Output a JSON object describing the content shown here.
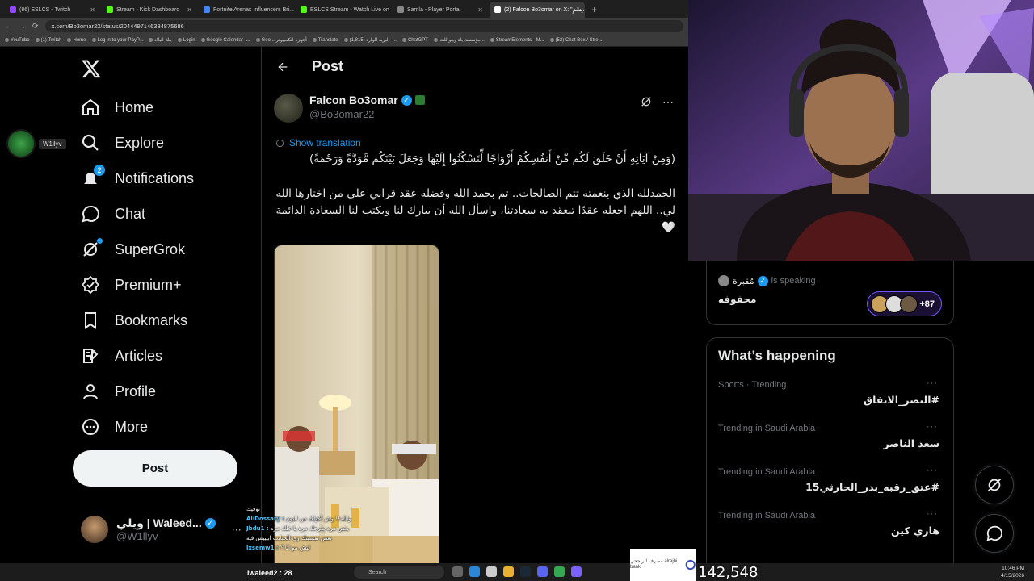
{
  "browser": {
    "tabs": [
      {
        "label": "(86) ESLCS - Twitch",
        "color": "#9146ff"
      },
      {
        "label": "Stream - Kick Dashboard",
        "color": "#53fc18"
      },
      {
        "label": "Fortnite Arenas Influencers Bri...",
        "color": "#4285f4"
      },
      {
        "label": "ESLCS Stream - Watch Live on ...",
        "color": "#53fc18"
      },
      {
        "label": "Samla - Player Portal",
        "color": "#888888"
      },
      {
        "label": "(2) Falcon Bo3omar on X: \"بِسْمِ...",
        "color": "#ffffff",
        "active": true
      }
    ],
    "new_tab": "+",
    "url": "x.com/Bo3omar22/status/2044497146334875686",
    "bookmarks": [
      "YouTube",
      "(1) Twitch",
      "Home",
      "Log in to your PayP...",
      "بنك البلاد",
      "Login",
      "Google Calendar -...",
      "Goo... أجهزة الكمبيوتر",
      "Translate",
      "(1,815) البريد الوارد -...",
      "ChatGPT",
      "مؤسسة باه ويلو للت...",
      "StreamElements - M...",
      "(52) Chat Box / Stre..."
    ]
  },
  "sidebar": {
    "items": [
      {
        "label": "Home",
        "icon": "home-icon"
      },
      {
        "label": "Explore",
        "icon": "search-icon"
      },
      {
        "label": "Notifications",
        "icon": "bell-icon",
        "badge": "2"
      },
      {
        "label": "Chat",
        "icon": "chat-icon"
      },
      {
        "label": "SuperGrok",
        "icon": "grok-icon"
      },
      {
        "label": "Premium+",
        "icon": "premium-icon"
      },
      {
        "label": "Bookmarks",
        "icon": "bookmark-icon"
      },
      {
        "label": "Articles",
        "icon": "articles-icon"
      },
      {
        "label": "Profile",
        "icon": "profile-icon"
      },
      {
        "label": "More",
        "icon": "more-icon"
      }
    ],
    "post_button": "Post",
    "account": {
      "name": "ويلي | Waleed...",
      "handle": "@W1llyv"
    },
    "overlay_user": "W1llyv"
  },
  "post": {
    "header_title": "Post",
    "author_name": "Falcon Bo3omar",
    "author_handle": "@Bo3omar22",
    "show_translation": "Show translation",
    "verse": "(وَمِنْ آيَاتِهِ أَنْ خَلَقَ لَكُم مِّنْ أَنفُسِكُمْ أَزْوَاجًا لِّتَسْكُنُوا إِلَيْهَا وَجَعَلَ بَيْنَكُم مَّوَدَّةً وَرَحْمَةً)",
    "body": "الحمدلله الذي بنعمته تتم الصالحات.. تم بحمد الله وفضله عقد قراني على من اختارها الله لي.. اللهم اجعله عقدًا تنعقد به سعادتنا، واسأل الله أن يبارك لنا ويكتب لنا السعادة الدائمة 🤍"
  },
  "space": {
    "host": "مُقبرة",
    "status": "is speaking",
    "title": "محفوفه",
    "listeners": "+87"
  },
  "happening": {
    "title": "What’s happening",
    "trends": [
      {
        "meta": "Sports · Trending",
        "name": "#النصر_الاتفاق"
      },
      {
        "meta": "Trending in Saudi Arabia",
        "name": "سعد الناصر"
      },
      {
        "meta": "Trending in Saudi Arabia",
        "name": "#عتق_رقبه_بدر_الحارثي15"
      },
      {
        "meta": "Trending in Saudi Arabia",
        "name": "هاري كين"
      }
    ],
    "more": "···"
  },
  "chat_overlay": {
    "lines": [
      {
        "user": "",
        "text": "توفيك"
      },
      {
        "user": "AliDossary :",
        "text": "والله!! وش أقولك من اليوم"
      },
      {
        "user": "Jbdu1 :",
        "text": "بغض مره يفرحك مره يا علك مره"
      },
      {
        "user": "",
        "text": "بغض نفسيتك زي الحبايب ابيييش فيه"
      },
      {
        "user": "lxsemw1 :",
        "text": "ليش مو انا ؟"
      }
    ],
    "sub_count": "iwaleed2 : 28"
  },
  "stream_counter": "142,548",
  "taskbar": {
    "search": "Search",
    "time": "10:46 PM",
    "date": "4/15/2026"
  },
  "bank_logo_text": "مصرف الراجحي alrajhi bank",
  "colors": {
    "accent": "#1d9bf0",
    "border": "#2f3336",
    "muted": "#71767b",
    "space_purple": "#7856ff"
  }
}
